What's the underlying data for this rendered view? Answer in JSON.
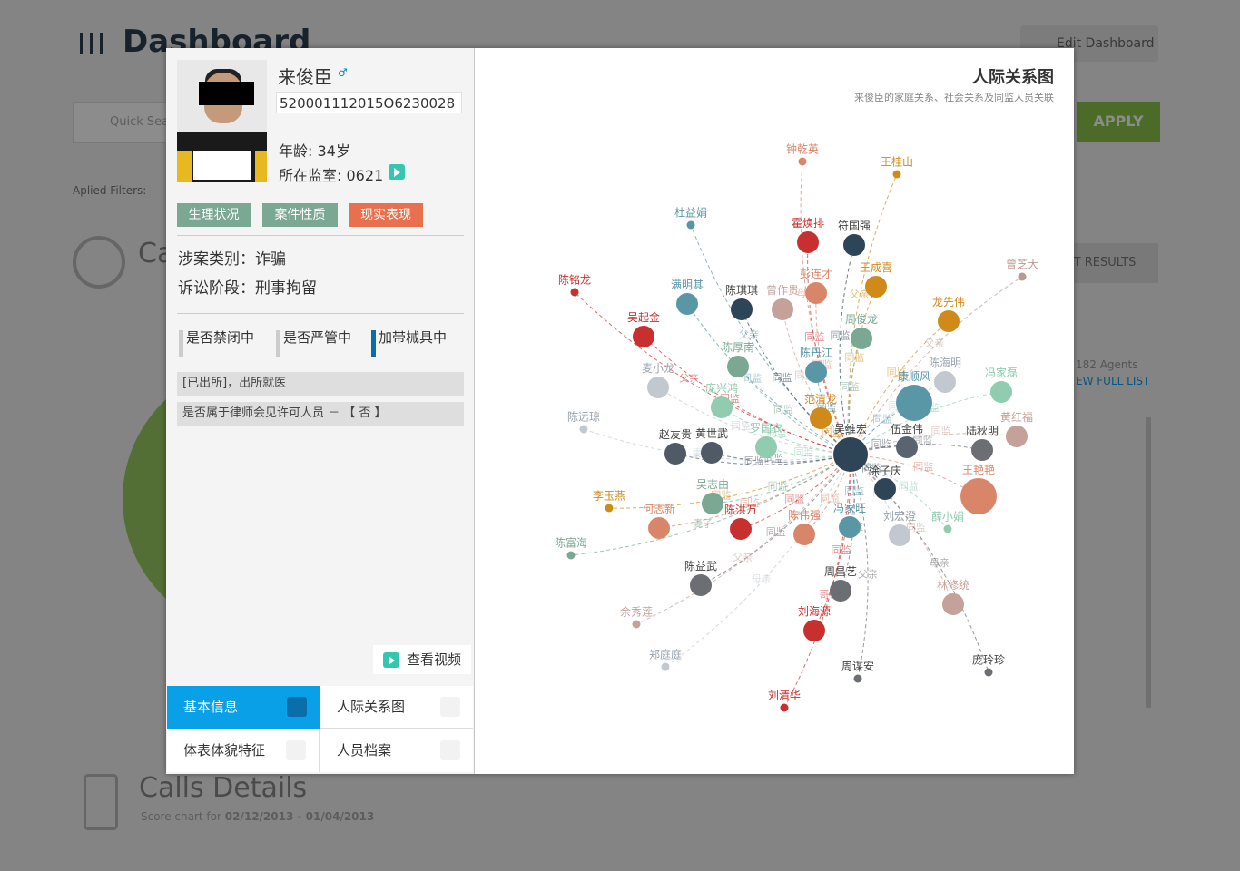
{
  "background": {
    "dashboard_title": "Dashboard",
    "edit_dashboard": "Edit Dashboard",
    "search_placeholder": "Quick Search",
    "apply": "APPLY",
    "applied_filters": "Aplied Filters:",
    "section_ca": "Ca",
    "export_results": "RT RESULTS",
    "agents_count": "182 Agents",
    "view_full_list": "EW FULL LIST",
    "calls_title": "Calls Details",
    "calls_sub_prefix": "Score chart for",
    "calls_sub_range": "02/12/2013 - 01/04/2013"
  },
  "profile": {
    "name": "来俊臣",
    "gender_icon": "male-icon",
    "id_number": "520001112015O6230028",
    "age": "年龄: 34岁",
    "cell": "所在监室: 0621",
    "tags": [
      "生理状况",
      "案件性质",
      "现实表现"
    ],
    "tag_colors": [
      "#7aa892",
      "#7aa892",
      "#e8704f"
    ],
    "crime_type": "涉案类别：诈骗",
    "lawsuit_stage": "诉讼阶段：刑事拘留",
    "flags": [
      {
        "label": "是否禁闭中",
        "active": false
      },
      {
        "label": "是否严管中",
        "active": false
      },
      {
        "label": "加带械具中",
        "active": true
      }
    ],
    "notes": [
      "[已出所]，出所就医",
      "是否属于律师会见许可人员 － 【 否 】"
    ],
    "view_video": "查看视频"
  },
  "tabs": [
    {
      "label": "基本信息",
      "active": true
    },
    {
      "label": "人际关系图",
      "active": false
    },
    {
      "label": "体表体貌特征",
      "active": false
    },
    {
      "label": "人员档案",
      "active": false
    }
  ],
  "graph": {
    "title": "人际关系图",
    "subtitle": "来俊臣的家庭关系、社会关系及同监人员关联",
    "nodes": [
      {
        "id": "吴维宏",
        "color": "#2e4457"
      },
      {
        "id": "钟乾英",
        "color": "#d9856a"
      },
      {
        "id": "王桂山",
        "color": "#d08a1a"
      },
      {
        "id": "杜益娟",
        "color": "#5a97a6"
      },
      {
        "id": "霍焕排",
        "color": "#c8302f"
      },
      {
        "id": "符国强",
        "color": "#2e4457"
      },
      {
        "id": "曾芝大",
        "color": "#b99a91"
      },
      {
        "id": "陈铭龙",
        "color": "#c8302f"
      },
      {
        "id": "满明其",
        "color": "#5a97a6"
      },
      {
        "id": "陈琪琪",
        "color": "#2e4457"
      },
      {
        "id": "曾作贵",
        "color": "#c4a199"
      },
      {
        "id": "彭连才",
        "color": "#d9856a"
      },
      {
        "id": "王成喜",
        "color": "#d08a1a"
      },
      {
        "id": "龙先伟",
        "color": "#d08a1a"
      },
      {
        "id": "吴起金",
        "color": "#c8302f"
      },
      {
        "id": "周俊龙",
        "color": "#7aa892"
      },
      {
        "id": "陈厚南",
        "color": "#7aa892"
      },
      {
        "id": "陈丹江",
        "color": "#5a97a6"
      },
      {
        "id": "陈海明",
        "color": "#c2c8cf"
      },
      {
        "id": "冯家磊",
        "color": "#8fccb0"
      },
      {
        "id": "麦小龙",
        "color": "#c2c8cf"
      },
      {
        "id": "康顺风",
        "color": "#5a97a6"
      },
      {
        "id": "庞兴鸿",
        "color": "#8fccb0"
      },
      {
        "id": "范清龙",
        "color": "#d08a1a"
      },
      {
        "id": "陈远琼",
        "color": "#c2c8cf"
      },
      {
        "id": "黄红福",
        "color": "#c4a199"
      },
      {
        "id": "罗国衣",
        "color": "#8fccb0"
      },
      {
        "id": "伍金伟",
        "color": "#5a6470"
      },
      {
        "id": "陆秋明",
        "color": "#6b6e72"
      },
      {
        "id": "赵友贵",
        "color": "#4f5a66"
      },
      {
        "id": "黄世武",
        "color": "#4f5a66"
      },
      {
        "id": "徐子庆",
        "color": "#2e4457"
      },
      {
        "id": "王艳艳",
        "color": "#d9856a"
      },
      {
        "id": "吴志由",
        "color": "#7aa892"
      },
      {
        "id": "李玉燕",
        "color": "#d08a1a"
      },
      {
        "id": "何志新",
        "color": "#d9856a"
      },
      {
        "id": "陈洪万",
        "color": "#c8302f"
      },
      {
        "id": "冯家旺",
        "color": "#5a97a6"
      },
      {
        "id": "刘宏澄",
        "color": "#c2c8cf"
      },
      {
        "id": "薛小娟",
        "color": "#8fccb0"
      },
      {
        "id": "陈伟强",
        "color": "#d9856a"
      },
      {
        "id": "陈富海",
        "color": "#7aa892"
      },
      {
        "id": "陈益武",
        "color": "#6b6e72"
      },
      {
        "id": "周昌艺",
        "color": "#6b6e72"
      },
      {
        "id": "林修统",
        "color": "#c4a199"
      },
      {
        "id": "余秀莲",
        "color": "#c4a199"
      },
      {
        "id": "刘海源",
        "color": "#c8302f"
      },
      {
        "id": "郑庭庭",
        "color": "#c2c8cf"
      },
      {
        "id": "周谋安",
        "color": "#6b6e72"
      },
      {
        "id": "庞玲珍",
        "color": "#6b6e72"
      },
      {
        "id": "刘清华",
        "color": "#c8302f"
      }
    ],
    "edge_labels": [
      "母亲",
      "父亲",
      "妻子",
      "同监",
      "同案"
    ]
  }
}
